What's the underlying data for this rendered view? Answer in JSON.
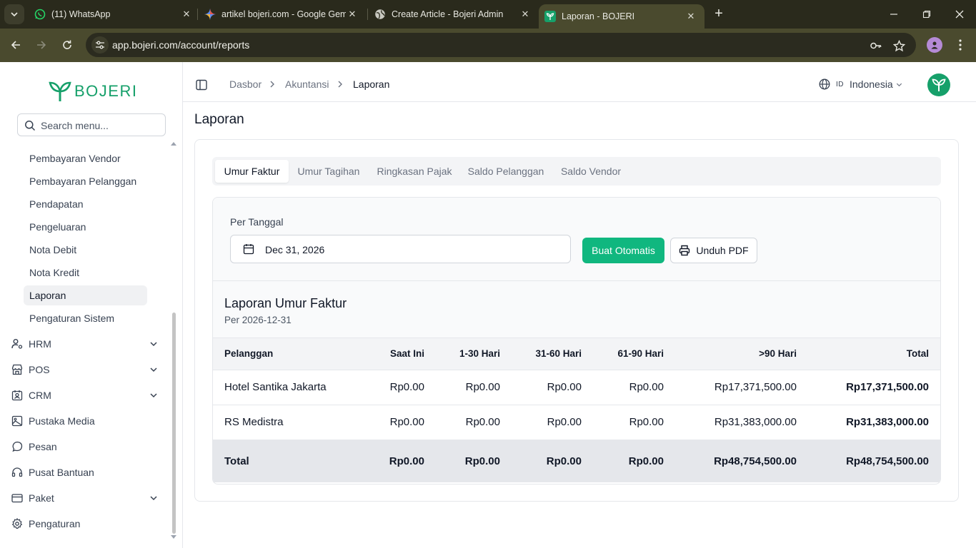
{
  "browser": {
    "tabs": [
      {
        "title": "(11) WhatsApp",
        "icon": "whatsapp-icon",
        "active": false
      },
      {
        "title": "artikel bojeri.com - Google Gem",
        "icon": "gemini-icon",
        "active": false
      },
      {
        "title": "Create Article - Bojeri Admin",
        "icon": "globe-icon",
        "active": false
      },
      {
        "title": "Laporan - BOJERI",
        "icon": "bojeri-icon",
        "active": true
      }
    ],
    "url": "app.bojeri.com/account/reports"
  },
  "sidebar": {
    "logo_text": "BOJERI",
    "search_placeholder": "Search menu...",
    "sub_items": [
      {
        "label": "Pembayaran Vendor",
        "active": false
      },
      {
        "label": "Pembayaran Pelanggan",
        "active": false
      },
      {
        "label": "Pendapatan",
        "active": false
      },
      {
        "label": "Pengeluaran",
        "active": false
      },
      {
        "label": "Nota Debit",
        "active": false
      },
      {
        "label": "Nota Kredit",
        "active": false
      },
      {
        "label": "Laporan",
        "active": true
      },
      {
        "label": "Pengaturan Sistem",
        "active": false
      }
    ],
    "main_items": [
      {
        "label": "HRM",
        "icon": "user-cog-icon",
        "expandable": true
      },
      {
        "label": "POS",
        "icon": "store-icon",
        "expandable": true
      },
      {
        "label": "CRM",
        "icon": "contact-icon",
        "expandable": true
      },
      {
        "label": "Pustaka Media",
        "icon": "image-icon",
        "expandable": false
      },
      {
        "label": "Pesan",
        "icon": "message-icon",
        "expandable": false
      },
      {
        "label": "Pusat Bantuan",
        "icon": "headset-icon",
        "expandable": false
      },
      {
        "label": "Paket",
        "icon": "credit-card-icon",
        "expandable": true
      },
      {
        "label": "Pengaturan",
        "icon": "gear-icon",
        "expandable": false
      }
    ]
  },
  "header": {
    "breadcrumb": [
      "Dasbor",
      "Akuntansi",
      "Laporan"
    ],
    "lang_code": "ID",
    "lang_name": "Indonesia"
  },
  "page": {
    "title": "Laporan",
    "tabs": [
      {
        "label": "Umur Faktur",
        "active": true
      },
      {
        "label": "Umur Tagihan",
        "active": false
      },
      {
        "label": "Ringkasan Pajak",
        "active": false
      },
      {
        "label": "Saldo Pelanggan",
        "active": false
      },
      {
        "label": "Saldo Vendor",
        "active": false
      }
    ],
    "date_label": "Per Tanggal",
    "date_value": "Dec 31, 2026",
    "generate_button": "Buat Otomatis",
    "download_button": "Unduh PDF",
    "report_title": "Laporan Umur Faktur",
    "report_subtitle": "Per 2026-12-31"
  },
  "table": {
    "columns": [
      "Pelanggan",
      "Saat Ini",
      "1-30 Hari",
      "31-60 Hari",
      "61-90 Hari",
      ">90 Hari",
      "Total"
    ],
    "rows": [
      [
        "Hotel Santika Jakarta",
        "Rp0.00",
        "Rp0.00",
        "Rp0.00",
        "Rp0.00",
        "Rp17,371,500.00",
        "Rp17,371,500.00"
      ],
      [
        "RS Medistra",
        "Rp0.00",
        "Rp0.00",
        "Rp0.00",
        "Rp0.00",
        "Rp31,383,000.00",
        "Rp31,383,000.00"
      ]
    ],
    "footer": [
      "Total",
      "Rp0.00",
      "Rp0.00",
      "Rp0.00",
      "Rp0.00",
      "Rp48,754,500.00",
      "Rp48,754,500.00"
    ]
  },
  "colors": {
    "brand": "#16a06a",
    "primary_button": "#10b77f",
    "browser_frame": "#4a4a2e"
  }
}
